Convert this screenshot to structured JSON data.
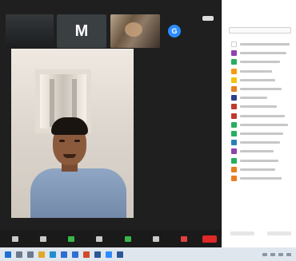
{
  "strip": {
    "tile1": {
      "title": "",
      "name": ""
    },
    "tile2": {
      "initial": "M",
      "name": ""
    },
    "tile3": {
      "name": ""
    },
    "tile4": {
      "initial": "G"
    }
  },
  "participants_panel": {
    "title": "",
    "search_placeholder": "",
    "rows": [
      {
        "avatar_color": "#ffffff"
      },
      {
        "avatar_color": "#8e44ad"
      },
      {
        "avatar_color": "#27ae60"
      },
      {
        "avatar_color": "#f39c12"
      },
      {
        "avatar_color": "#f1c40f"
      },
      {
        "avatar_color": "#e67e22"
      },
      {
        "avatar_color": "#2c3e8c"
      },
      {
        "avatar_color": "#c0392b"
      },
      {
        "avatar_color": "#c0392b"
      },
      {
        "avatar_color": "#27ae60"
      },
      {
        "avatar_color": "#27ae60"
      },
      {
        "avatar_color": "#2980b9"
      },
      {
        "avatar_color": "#8e44ad"
      },
      {
        "avatar_color": "#27ae60"
      },
      {
        "avatar_color": "#e67e22"
      },
      {
        "avatar_color": "#e67e22"
      }
    ]
  },
  "toolbar": {
    "buttons": [
      {
        "icon": "microphone-icon",
        "color": "#c9c9c9"
      },
      {
        "icon": "video-icon",
        "color": "#c9c9c9"
      },
      {
        "icon": "participants-icon",
        "color": "#3ab54a"
      },
      {
        "icon": "chat-icon",
        "color": "#c9c9c9"
      },
      {
        "icon": "share-screen-icon",
        "color": "#3ab54a"
      },
      {
        "icon": "record-icon",
        "color": "#c9c9c9"
      },
      {
        "icon": "reactions-icon",
        "color": "#e04040"
      }
    ],
    "leave_color": "#e02828"
  },
  "taskbar": {
    "icons": [
      {
        "icon": "start-icon",
        "color": "#1f6fd1"
      },
      {
        "icon": "search-icon",
        "color": "#6b7a8c"
      },
      {
        "icon": "task-view-icon",
        "color": "#6b7a8c"
      },
      {
        "icon": "file-explorer-icon",
        "color": "#e0a82e"
      },
      {
        "icon": "edge-icon",
        "color": "#1f8fd1"
      },
      {
        "icon": "store-icon",
        "color": "#2d6fd1"
      },
      {
        "icon": "mail-icon",
        "color": "#2d6fd1"
      },
      {
        "icon": "chrome-icon",
        "color": "#d14a2d"
      },
      {
        "icon": "word-icon",
        "color": "#2b5797"
      },
      {
        "icon": "zoom-icon",
        "color": "#2d8cff"
      },
      {
        "icon": "app-icon",
        "color": "#2b5797"
      }
    ]
  }
}
